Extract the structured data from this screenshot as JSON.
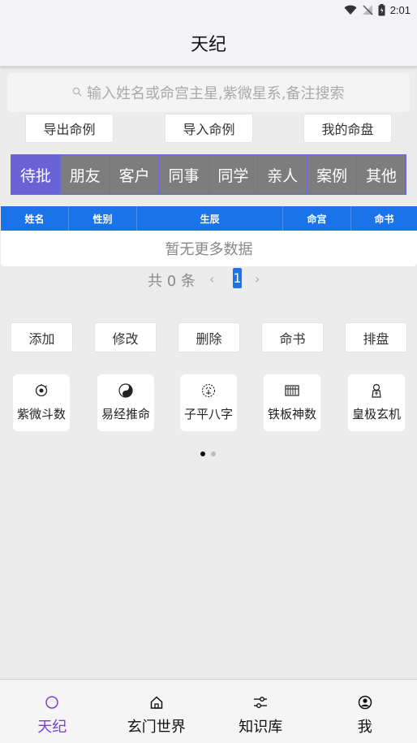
{
  "status": {
    "time": "2:01"
  },
  "app": {
    "title": "天纪"
  },
  "search": {
    "placeholder": "输入姓名或命宫主星,紫微星系,备注搜索"
  },
  "top_buttons": [
    "导出命例",
    "导入命例",
    "我的命盘"
  ],
  "tabs": [
    "待批",
    "朋友",
    "客户",
    "同事",
    "同学",
    "亲人",
    "案例",
    "其他"
  ],
  "active_tab": "待批",
  "table": {
    "headers": [
      "姓名",
      "性别",
      "生辰",
      "命宫",
      "命书"
    ],
    "empty_text": "暂无更多数据"
  },
  "pagination": {
    "total_text": "共 0 条",
    "prev": "‹",
    "current": "1",
    "next": "›"
  },
  "actions": [
    "添加",
    "修改",
    "删除",
    "命书",
    "排盘"
  ],
  "tools": [
    {
      "label": "紫微斗数",
      "icon": "ziwei-icon"
    },
    {
      "label": "易经推命",
      "icon": "taiji-icon"
    },
    {
      "label": "子平八字",
      "icon": "bazi-icon"
    },
    {
      "label": "铁板神数",
      "icon": "abacus-icon"
    },
    {
      "label": "皇极玄机",
      "icon": "sage-icon"
    }
  ],
  "carousel": {
    "pages": 2,
    "active": 0
  },
  "bottom_nav": [
    {
      "label": "天纪",
      "icon": "circle-icon",
      "active": true
    },
    {
      "label": "玄门世界",
      "icon": "home-icon",
      "active": false
    },
    {
      "label": "知识库",
      "icon": "sliders-icon",
      "active": false
    },
    {
      "label": "我",
      "icon": "user-icon",
      "active": false
    }
  ],
  "colors": {
    "accent": "#6a63d6",
    "table_header": "#1a73e8",
    "nav_active": "#7b3fd0"
  }
}
